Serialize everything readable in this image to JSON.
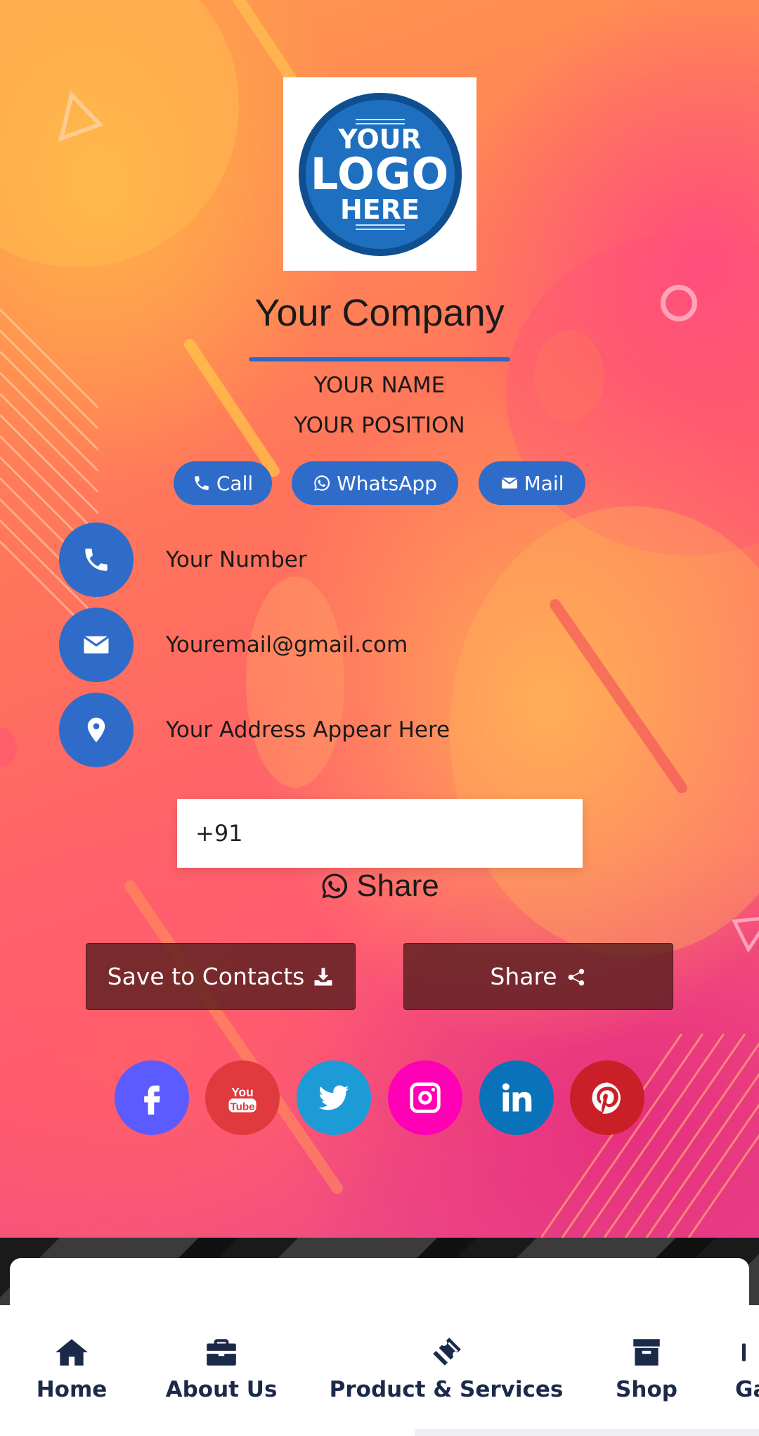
{
  "logo": {
    "line1": "YOUR",
    "line2": "LOGO",
    "line3": "HERE"
  },
  "company": "Your Company",
  "person": {
    "name": "YOUR NAME",
    "position": "YOUR POSITION"
  },
  "actions": {
    "call": "Call",
    "whatsapp": "WhatsApp",
    "mail": "Mail"
  },
  "contact": {
    "phone": "Your Number",
    "email": "Youremail@gmail.com",
    "address": "Your Address Appear Here"
  },
  "share_form": {
    "phone_value": "+91",
    "share_label": "Share"
  },
  "buttons": {
    "save_contacts": "Save to Contacts",
    "share": "Share"
  },
  "social": [
    {
      "name": "facebook",
      "icon": "facebook-icon",
      "color": "#5b5bff"
    },
    {
      "name": "youtube",
      "icon": "youtube-icon",
      "color": "#e0393e"
    },
    {
      "name": "twitter",
      "icon": "twitter-icon",
      "color": "#1d9bd7"
    },
    {
      "name": "instagram",
      "icon": "instagram-icon",
      "color": "#ff00b4"
    },
    {
      "name": "linkedin",
      "icon": "linkedin-icon",
      "color": "#0a72b8"
    },
    {
      "name": "pinterest",
      "icon": "pinterest-icon",
      "color": "#cb1f27"
    }
  ],
  "nav": {
    "home": "Home",
    "about": "About Us",
    "products": "Product & Services",
    "shop": "Shop",
    "gallery_partial": "Ga"
  },
  "colors": {
    "accent": "#2f6cc9",
    "nav_text": "#1c2a4a",
    "dark_button": "#5a1e1e"
  }
}
